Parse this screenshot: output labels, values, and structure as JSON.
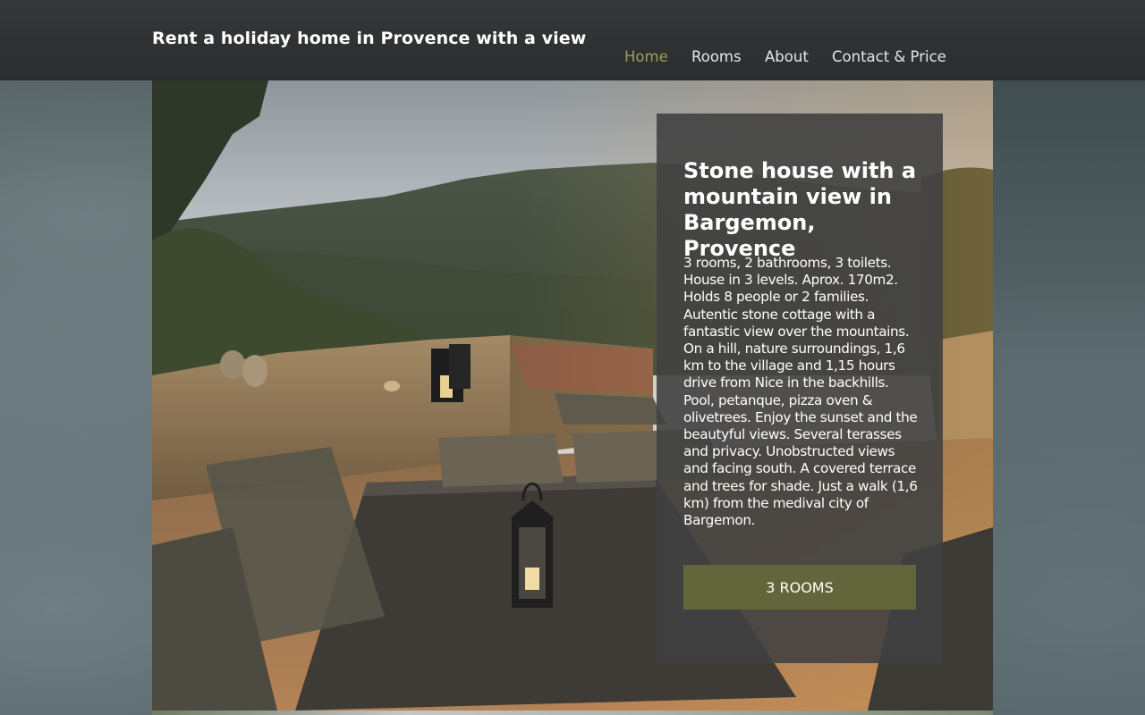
{
  "site": {
    "title": "Rent a holiday home in Provence with a view"
  },
  "nav": {
    "items": [
      {
        "label": "Home",
        "active": true
      },
      {
        "label": "Rooms",
        "active": false
      },
      {
        "label": "About",
        "active": false
      },
      {
        "label": "Contact & Price",
        "active": false
      }
    ]
  },
  "hero": {
    "image_description_icon": "terrace-photo"
  },
  "panel": {
    "title": "Stone house with a mountain view in Bargemon, Provence",
    "description": "3 rooms, 2 bathrooms, 3 toilets. House in 3 levels. Aprox. 170m2. Holds 8 people or 2 families. Autentic stone cottage with a fantastic view over the mountains. On a hill, nature surroundings, 1,6 km to the village and 1,15 hours drive from Nice in the backhills. Pool, petanque, pizza oven & olivetrees. Enjoy the sunset and the beautyful views. Several terasses and privacy. Unobstructed views and facing south. A covered terrace and trees for shade. Just a walk (1,6 km) from the medival city of Bargemon.",
    "button_label": "3 ROOMS"
  },
  "colors": {
    "header_bg": "#2e2f30",
    "nav_active": "#9aa05a",
    "button_bg": "#63663a",
    "panel_bg": "#414141"
  }
}
